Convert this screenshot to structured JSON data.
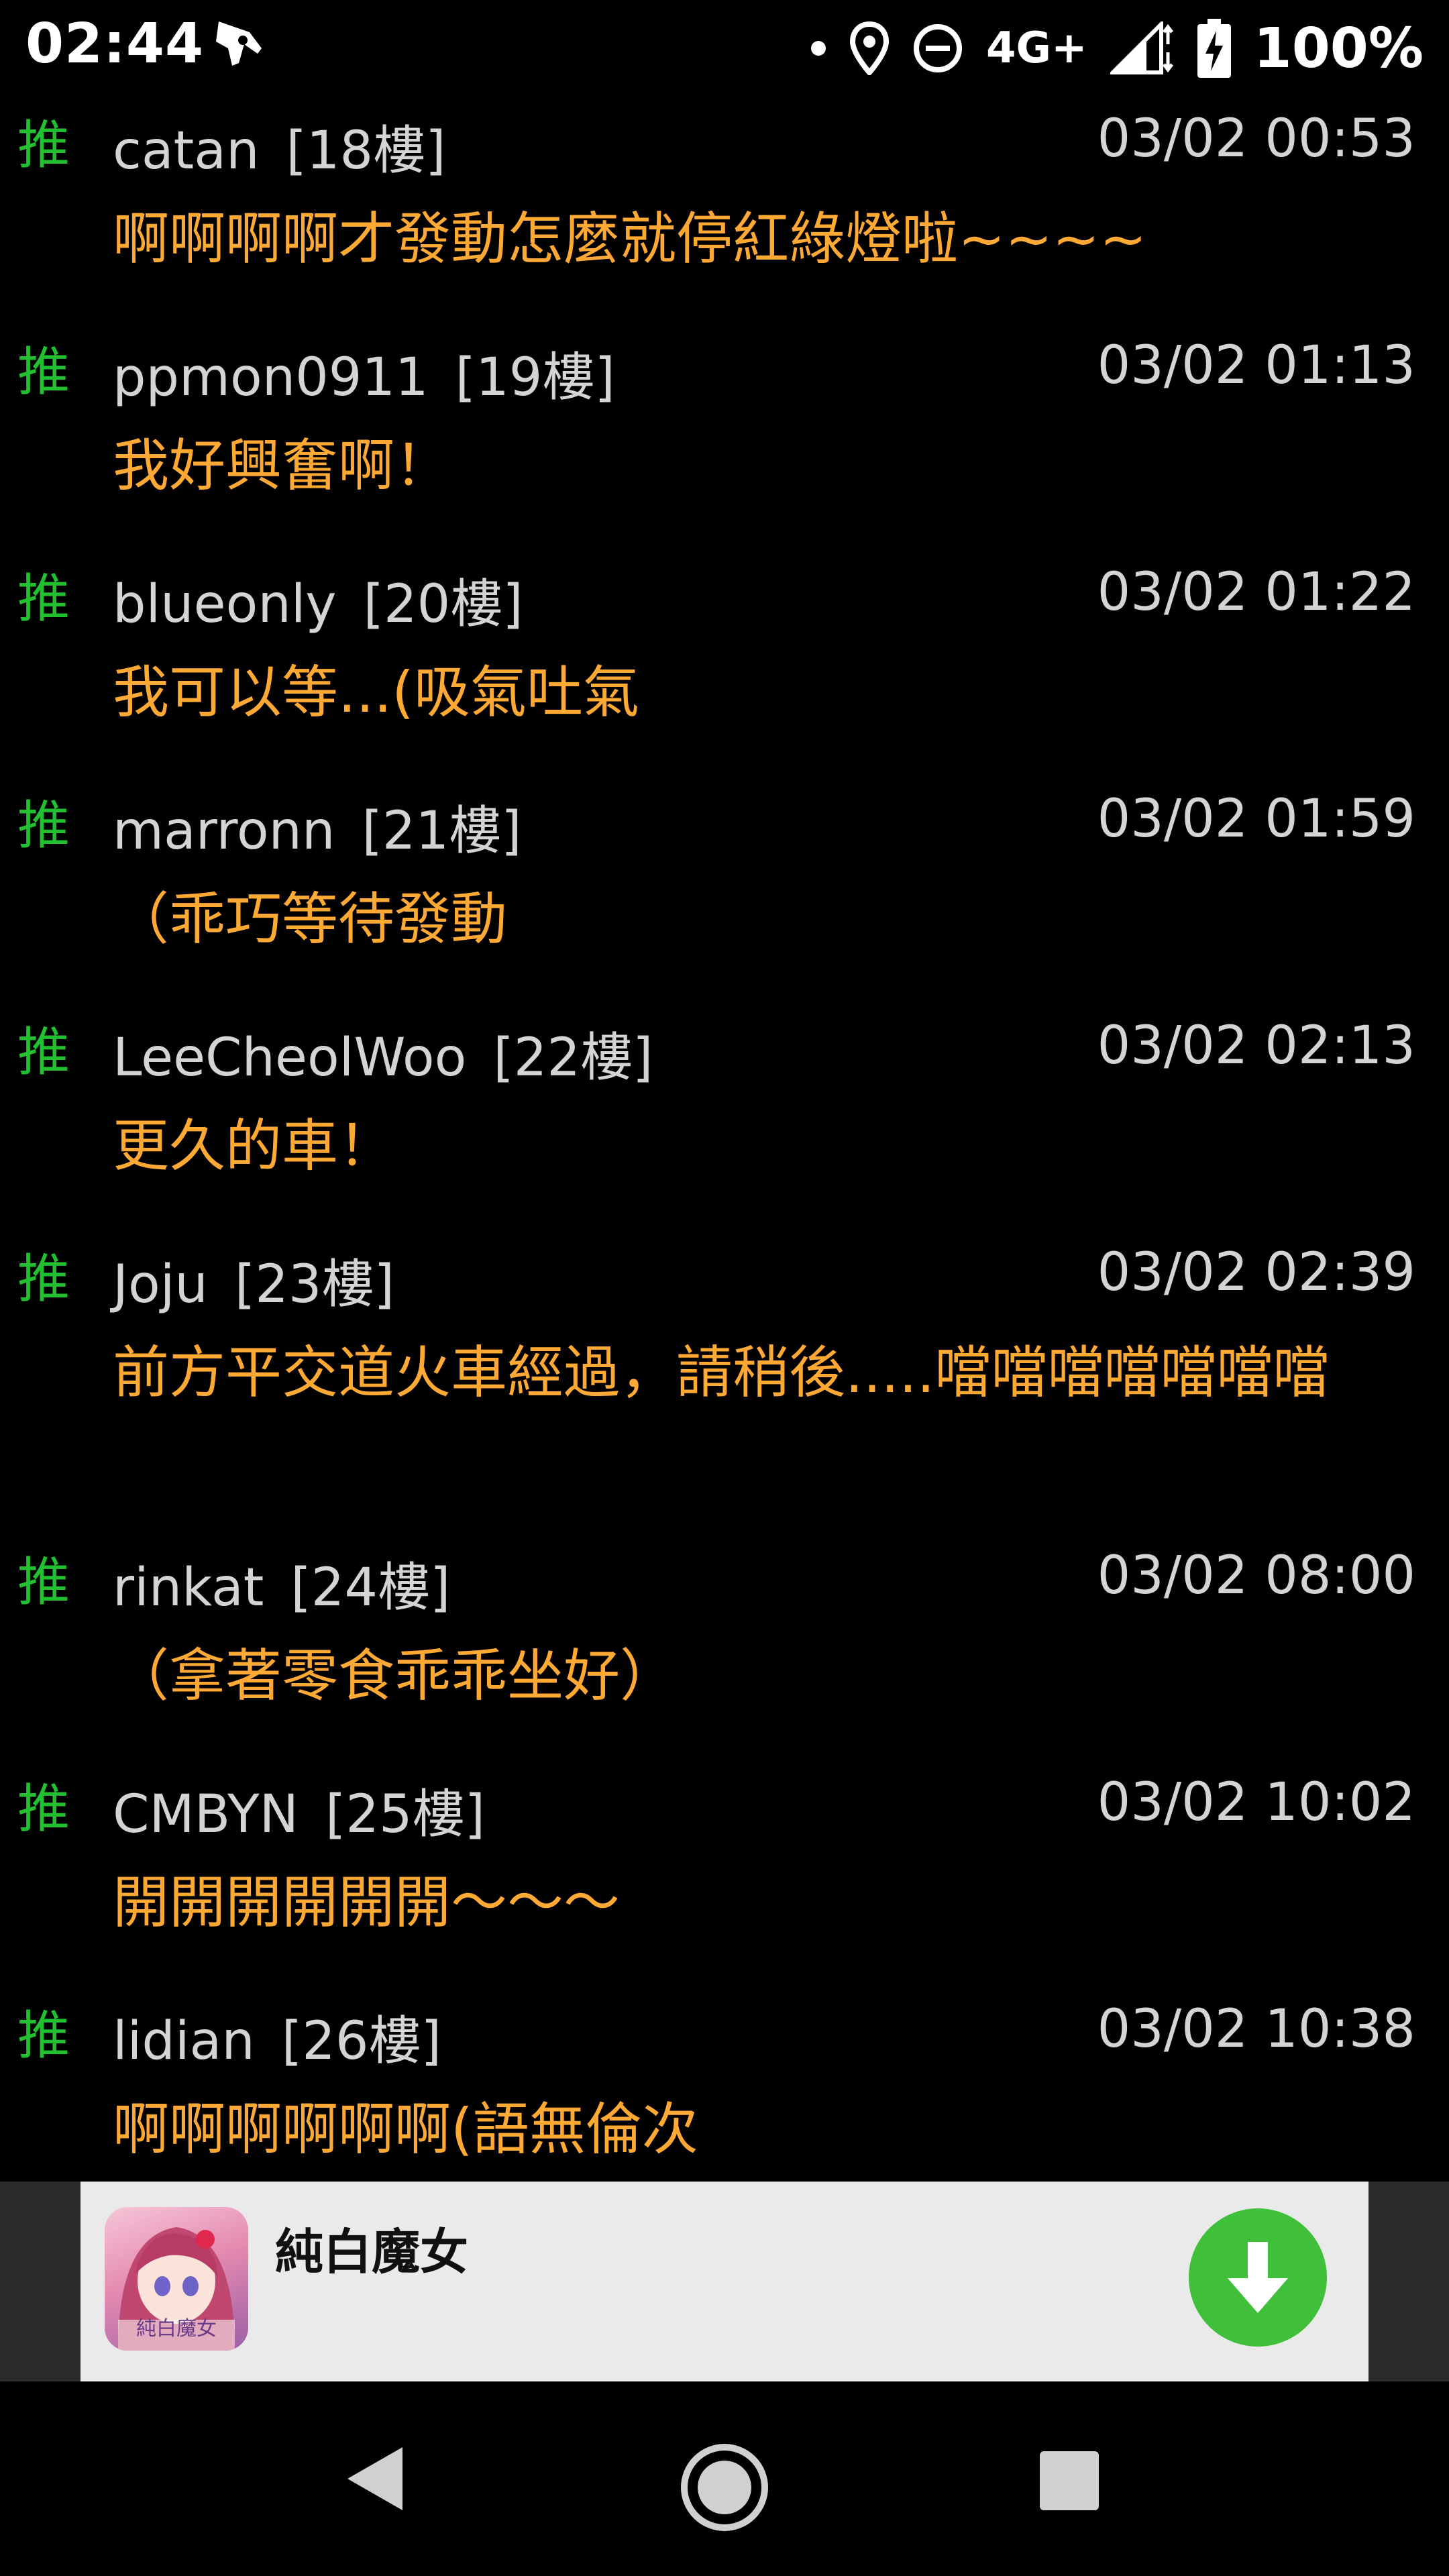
{
  "status_bar": {
    "time": "02:44",
    "network": "4G+",
    "battery": "100%",
    "icons": [
      "rocket-icon",
      "dot-icon",
      "location-icon",
      "do-not-disturb-icon",
      "signal-icon",
      "battery-charging-icon"
    ]
  },
  "comments": [
    {
      "push": "推",
      "user": "catan",
      "floor": "[18樓]",
      "time": "03/02 00:53",
      "text": "啊啊啊啊才發動怎麼就停紅綠燈啦~~~~"
    },
    {
      "push": "推",
      "user": "ppmon0911",
      "floor": "[19樓]",
      "time": "03/02 01:13",
      "text": "我好興奮啊！"
    },
    {
      "push": "推",
      "user": "blueonly",
      "floor": "[20樓]",
      "time": "03/02 01:22",
      "text": "我可以等...(吸氣吐氣"
    },
    {
      "push": "推",
      "user": "marronn",
      "floor": "[21樓]",
      "time": "03/02 01:59",
      "text": "（乖巧等待發動"
    },
    {
      "push": "推",
      "user": "LeeCheolWoo",
      "floor": "[22樓]",
      "time": "03/02 02:13",
      "text": "更久的車！"
    },
    {
      "push": "推",
      "user": "Joju",
      "floor": "[23樓]",
      "time": "03/02 02:39",
      "text": "前方平交道火車經過，請稍後.....噹噹噹噹噹噹噹"
    },
    {
      "push": "推",
      "user": "rinkat",
      "floor": "[24樓]",
      "time": "03/02 08:00",
      "text": "（拿著零食乖乖坐好）"
    },
    {
      "push": "推",
      "user": "CMBYN",
      "floor": "[25樓]",
      "time": "03/02 10:02",
      "text": "開開開開開開〜〜〜"
    },
    {
      "push": "推",
      "user": "lidian",
      "floor": "[26樓]",
      "time": "03/02 10:38",
      "text": "啊啊啊啊啊啊(語無倫次"
    }
  ],
  "ad": {
    "title": "純白魔女",
    "icon_text": "純白魔女",
    "download_icon": "download-arrow-icon"
  },
  "nav_bar": {
    "icons": [
      "back-triangle-icon",
      "home-circle-icon",
      "recents-square-icon"
    ]
  },
  "colors": {
    "push": "#22c030",
    "meta": "#d4d4d4",
    "comment_text": "#ffa935",
    "background": "#000000",
    "ad_bg": "#eaeaea",
    "download": "#3fbf3a"
  }
}
